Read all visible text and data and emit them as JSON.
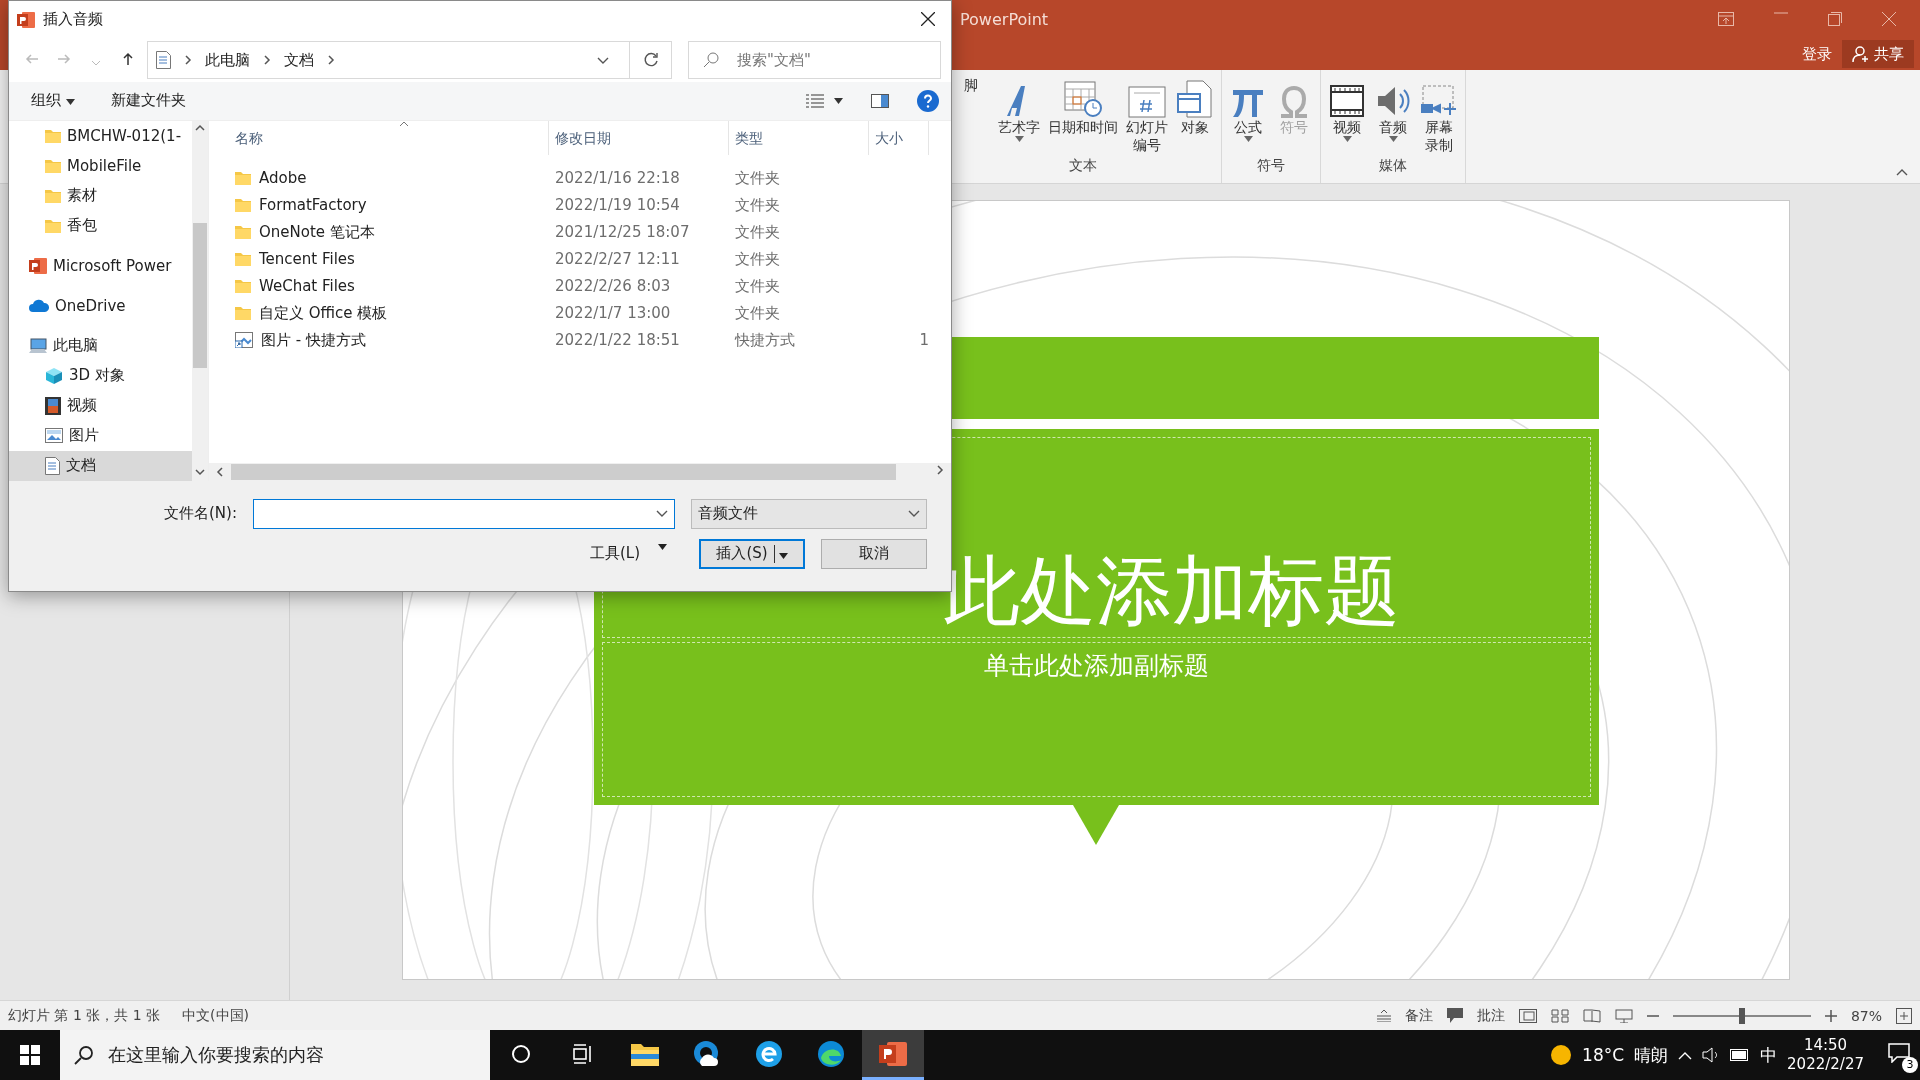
{
  "app": {
    "title": "PowerPoint",
    "sign_in": "登录",
    "share": "共享"
  },
  "ribbon": {
    "groups": [
      {
        "label": "文本",
        "buttons": [
          {
            "label": "脚",
            "dropdown": false,
            "disabled": false
          },
          {
            "label": "艺术字",
            "dropdown": true,
            "disabled": false
          },
          {
            "label": "日期和时间",
            "dropdown": false,
            "disabled": false
          },
          {
            "label": [
              "幻灯片",
              "编号"
            ],
            "dropdown": false,
            "disabled": false
          },
          {
            "label": "对象",
            "dropdown": false,
            "disabled": false
          }
        ]
      },
      {
        "label": "符号",
        "buttons": [
          {
            "label": "公式",
            "dropdown": true,
            "disabled": false
          },
          {
            "label": "符号",
            "dropdown": false,
            "disabled": true
          }
        ]
      },
      {
        "label": "媒体",
        "buttons": [
          {
            "label": "视频",
            "dropdown": true,
            "disabled": false
          },
          {
            "label": "音频",
            "dropdown": true,
            "disabled": false
          },
          {
            "label": [
              "屏幕",
              "录制"
            ],
            "dropdown": false,
            "disabled": false
          }
        ]
      }
    ]
  },
  "slide": {
    "title": "此处添加标题",
    "subtitle": "单击此处添加副标题"
  },
  "status_bar": {
    "slide_info": "幻灯片 第 1 张，共 1 张",
    "language": "中文(中国)",
    "notes": "备注",
    "comments": "批注",
    "zoom": {
      "level": 0.5,
      "reading": "87%"
    }
  },
  "taskbar": {
    "search_placeholder": "在这里输入你要搜索的内容",
    "apps": [
      {
        "kind": "task-view",
        "selected": false
      },
      {
        "kind": "explorer",
        "selected": false
      },
      {
        "kind": "cloud",
        "selected": false
      },
      {
        "kind": "ie",
        "selected": false
      },
      {
        "kind": "edge",
        "selected": false
      },
      {
        "kind": "powerpoint",
        "selected": true
      }
    ],
    "weather": {
      "temp": "18°C",
      "condition": "晴朗"
    },
    "ime": "中",
    "time": "14:50",
    "date": "2022/2/27",
    "notifications": "3"
  },
  "dialog": {
    "title": "插入音频",
    "breadcrumbs": [
      "此电脑",
      "文档"
    ],
    "search_placeholder": "搜索\"文档\"",
    "organize": "组织",
    "new_folder": "新建文件夹",
    "sidebar": [
      {
        "label": "BMCHW-012(1-",
        "kind": "folder",
        "selected": false
      },
      {
        "label": "MobileFile",
        "kind": "folder",
        "selected": false
      },
      {
        "label": "素材",
        "kind": "folder",
        "selected": false
      },
      {
        "label": "香包",
        "kind": "folder",
        "selected": false
      },
      {
        "label": "Microsoft Power",
        "kind": "app",
        "selected": false
      },
      {
        "label": "OneDrive",
        "kind": "cloud",
        "selected": false
      },
      {
        "label": "此电脑",
        "kind": "pc",
        "selected": false,
        "children": [
          {
            "label": "3D 对象",
            "kind": "cube",
            "selected": false
          },
          {
            "label": "视频",
            "kind": "video",
            "selected": false
          },
          {
            "label": "图片",
            "kind": "picture",
            "selected": false
          },
          {
            "label": "文档",
            "kind": "document",
            "selected": true
          }
        ]
      }
    ],
    "columns": [
      "名称",
      "修改日期",
      "类型",
      "大小"
    ],
    "files": [
      {
        "name": "Adobe",
        "modified": "2022/1/16 22:18",
        "type": "文件夹",
        "kind": "folder"
      },
      {
        "name": "FormatFactory",
        "modified": "2022/1/19 10:54",
        "type": "文件夹",
        "kind": "folder"
      },
      {
        "name": "OneNote 笔记本",
        "modified": "2021/12/25 18:07",
        "type": "文件夹",
        "kind": "folder"
      },
      {
        "name": "Tencent Files",
        "modified": "2022/2/27 12:11",
        "type": "文件夹",
        "kind": "folder"
      },
      {
        "name": "WeChat Files",
        "modified": "2022/2/26 8:03",
        "type": "文件夹",
        "kind": "folder"
      },
      {
        "name": "自定义 Office 模板",
        "modified": "2022/1/7 13:00",
        "type": "文件夹",
        "kind": "folder"
      },
      {
        "name": "图片 - 快捷方式",
        "modified": "2022/1/22 18:51",
        "type": "快捷方式",
        "size": "1",
        "kind": "shortcut"
      }
    ],
    "filename_label": "文件名(N):",
    "filter": "音频文件",
    "tools": "工具(L)",
    "insert": "插入(S)",
    "cancel": "取消"
  }
}
